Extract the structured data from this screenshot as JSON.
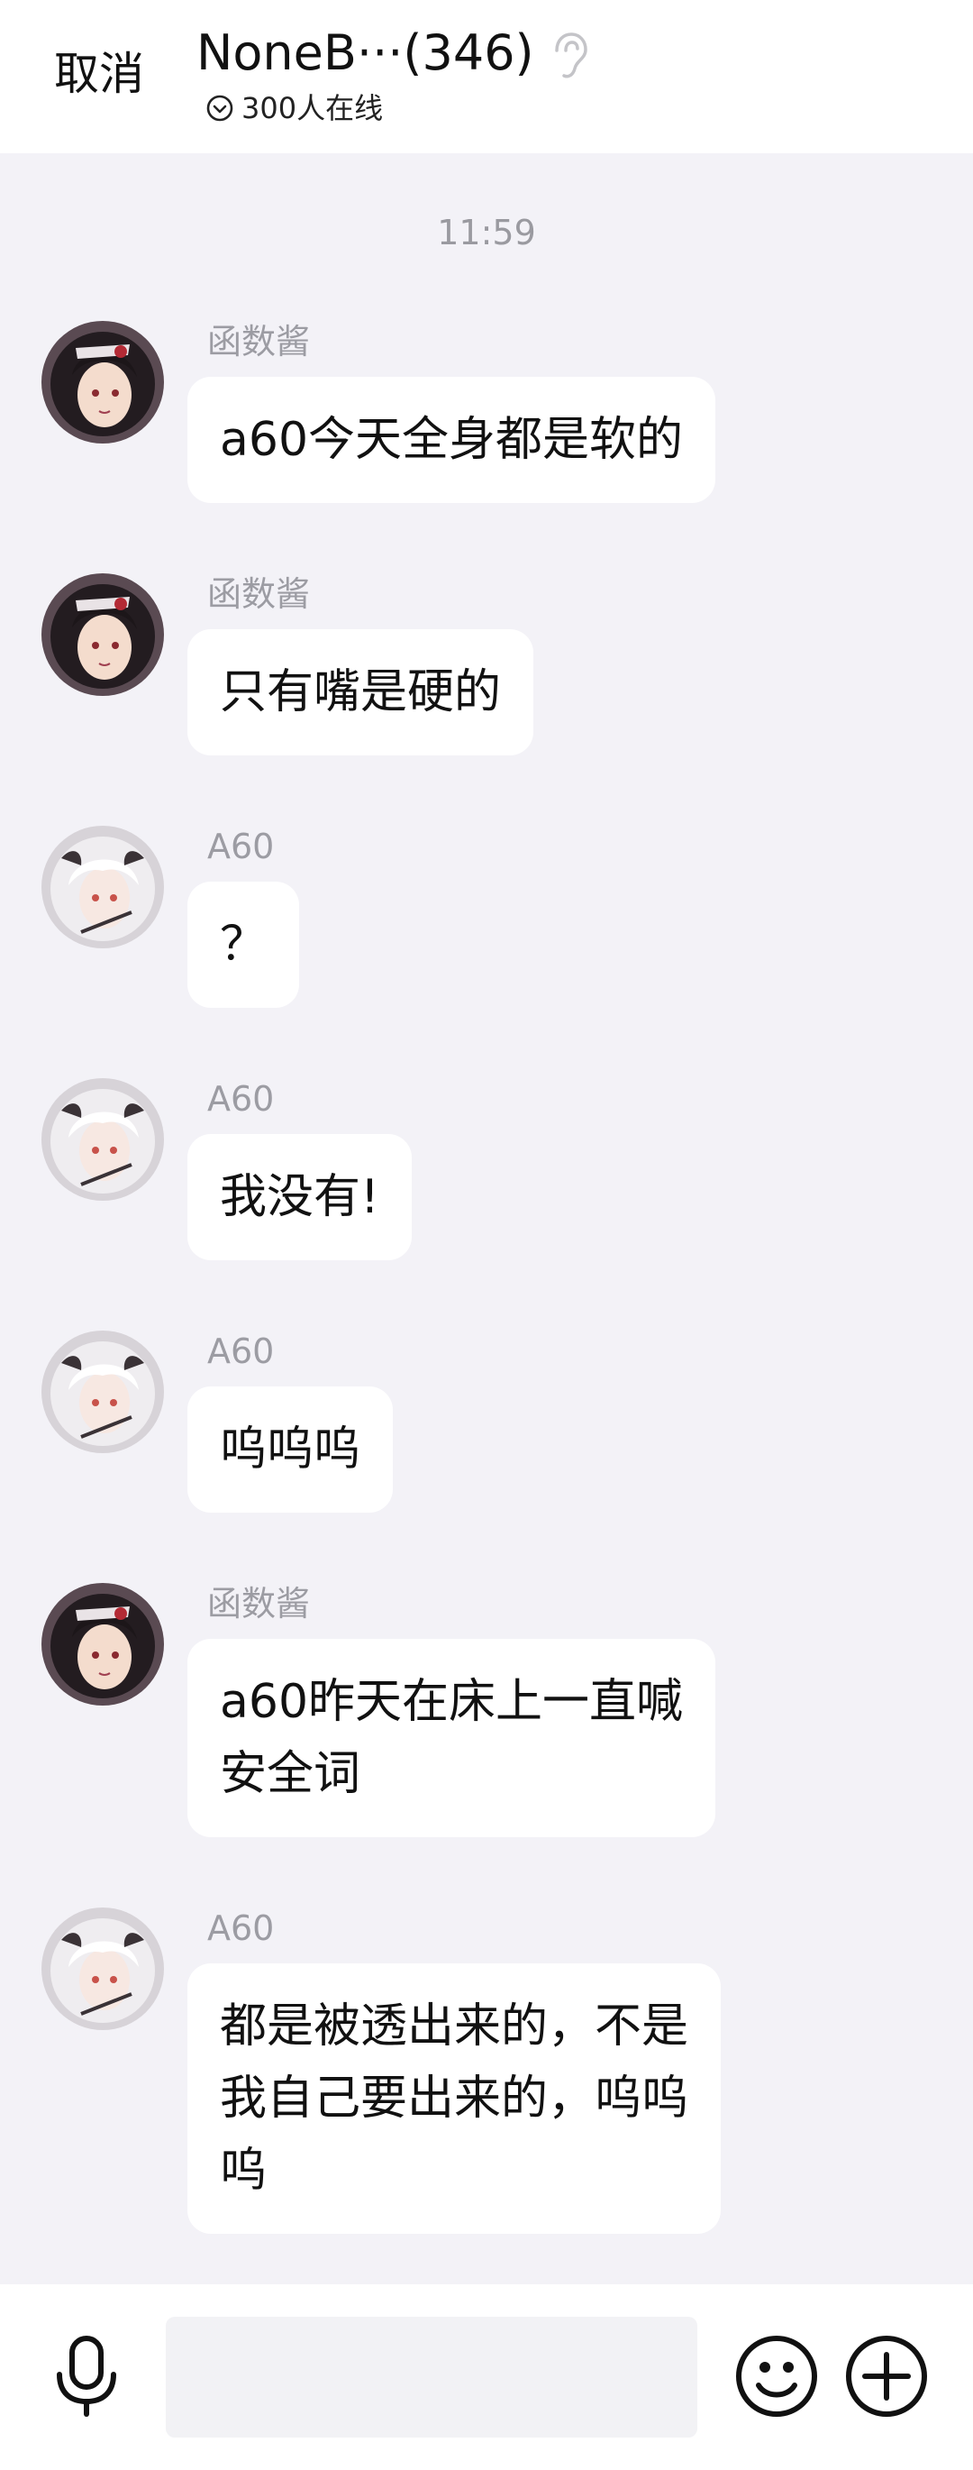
{
  "header": {
    "cancel_label": "取消",
    "title": "NoneB···(346)",
    "online_text": "300人在线",
    "ear_icon": "ear-icon",
    "online_icon": "chevron-circle-down-icon"
  },
  "chat": {
    "time": "11:59",
    "messages": [
      {
        "sender": "函数酱",
        "avatar": "avatar-dark-hair",
        "text": "a60今天全身都是软的"
      },
      {
        "sender": "函数酱",
        "avatar": "avatar-dark-hair",
        "text": "只有嘴是硬的"
      },
      {
        "sender": "A60",
        "avatar": "avatar-white-hair",
        "text": "？"
      },
      {
        "sender": "A60",
        "avatar": "avatar-white-hair",
        "text": "我没有!"
      },
      {
        "sender": "A60",
        "avatar": "avatar-white-hair",
        "text": "呜呜呜"
      },
      {
        "sender": "函数酱",
        "avatar": "avatar-dark-hair",
        "text": "a60昨天在床上一直喊\n安全词"
      },
      {
        "sender": "A60",
        "avatar": "avatar-white-hair",
        "text": "都是被透出来的，不是\n我自己要出来的，呜呜\n呜"
      }
    ]
  },
  "input_bar": {
    "value": "",
    "placeholder": "",
    "mic_icon": "microphone-icon",
    "emoji_icon": "smiley-icon",
    "plus_icon": "plus-circle-icon"
  },
  "colors": {
    "background": "#f3f2f7",
    "bubble": "#ffffff",
    "sender_text": "#9c9ca3",
    "dark_hair": "#2a2226",
    "white_hair": "#e9e6ea"
  }
}
